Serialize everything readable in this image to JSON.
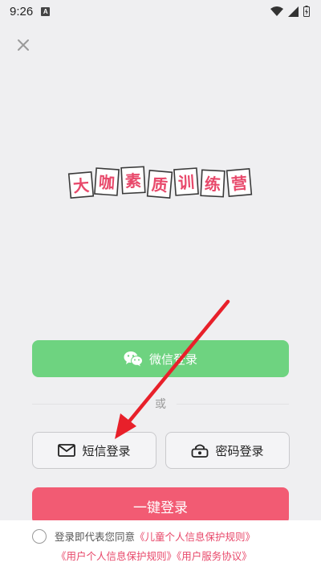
{
  "status_bar": {
    "time": "9:26",
    "notification_letter": "A"
  },
  "header": {
    "close_icon": "close-icon"
  },
  "logo": {
    "characters": [
      "大",
      "咖",
      "素",
      "质",
      "训",
      "练",
      "营"
    ],
    "text_color": "#e8496b",
    "tile_border": "#3a3a3a"
  },
  "login": {
    "wechat_label": "微信登录",
    "divider_text": "或",
    "sms_label": "短信登录",
    "password_label": "密码登录",
    "one_click_label": "一键登录"
  },
  "agreement": {
    "prefix": "登录即代表您同意",
    "child_privacy_link": "《儿童个人信息保护规则》",
    "user_privacy_link": "《用户个人信息保护规则》",
    "service_link": "《用户服务协议》"
  },
  "colors": {
    "background": "#efeff1",
    "wechat_green": "#6ed380",
    "primary_pink": "#f25b73",
    "link_pink": "#e8486a",
    "annotation_arrow": "#e8202a"
  }
}
